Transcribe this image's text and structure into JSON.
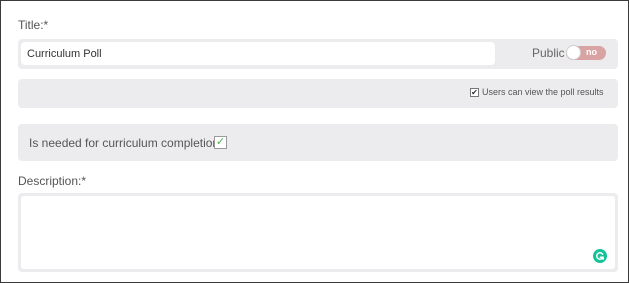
{
  "form": {
    "title_label": "Title:*",
    "title_value": "Curriculum Poll",
    "public_label": "Public",
    "public_toggle_text": "no",
    "results_checkbox_label": "Users can view the poll results",
    "results_checked": true,
    "needed_label": "Is needed for curriculum completion:",
    "needed_checked": true,
    "description_label": "Description:*",
    "description_value": ""
  },
  "icons": {
    "needed_check": "check-icon",
    "grammarly": "grammarly-icon"
  },
  "colors": {
    "toggle_off": "#d9a3a3",
    "check_green": "#4caf50",
    "grammarly_green": "#15c39a",
    "row_background": "#ececee"
  }
}
